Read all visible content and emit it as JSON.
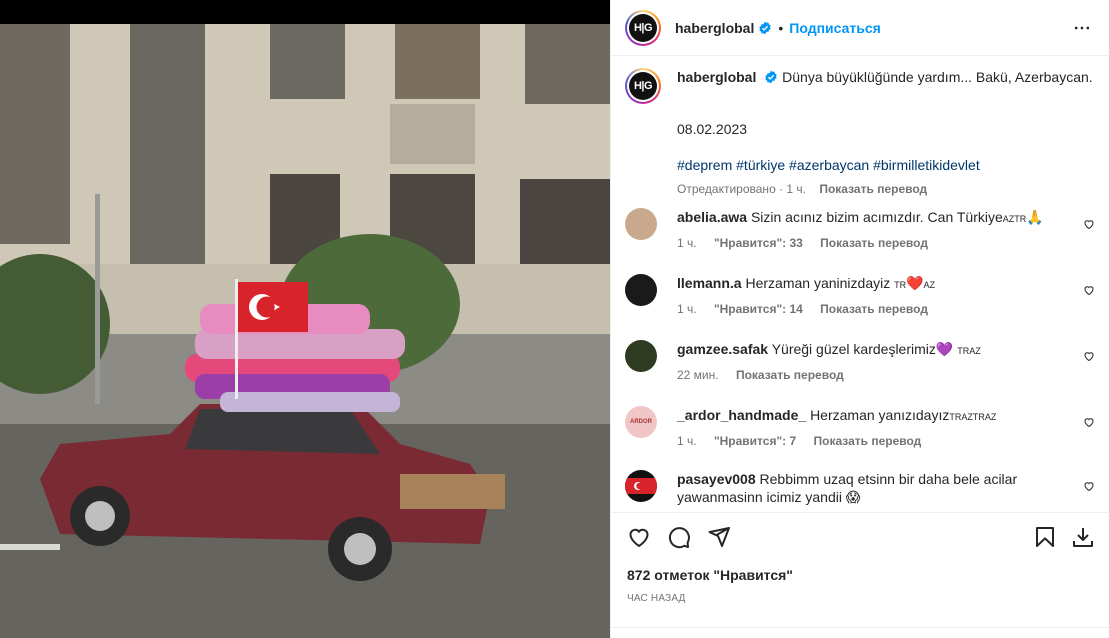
{
  "post": {
    "username": "haberglobal",
    "follow_label": "Подписаться",
    "dot": "•",
    "avatar_text": "H|G",
    "caption_text": "Dünya büyüklüğünde yardım... Bakü, Azerbaycan.",
    "date": "08.02.2023",
    "hashtags": "#deprem #türkiye #azerbaycan #birmilletikidevlet",
    "meta_edited": "Отредактировано · 1 ч.",
    "meta_translate": "Показать перевод"
  },
  "comments": [
    {
      "username": "abelia.awa",
      "text": "Sizin acınız bizim acımızdır. Can Türkiye",
      "suffix_small": "AZTR",
      "emoji": "🙏",
      "time": "1 ч.",
      "likes": "\"Нравится\": 33",
      "translate": "Показать перевод",
      "avatar_color": "#c9a98e"
    },
    {
      "username": "llemann.a",
      "text": "Herzaman yaninizdayiz ",
      "prefix_small": "TR",
      "emoji": "❤️",
      "suffix_small": "AZ",
      "time": "1 ч.",
      "likes": "\"Нравится\": 14",
      "translate": "Показать перевод",
      "avatar_color": "#1a1a1a"
    },
    {
      "username": "gamzee.safak",
      "text": "Yüreği güzel kardeşlerimiz",
      "emoji": "💜",
      "suffix_small": "TRAZ",
      "time": "22 мин.",
      "likes": "",
      "translate": "Показать перевод",
      "avatar_color": "#2f3b20"
    },
    {
      "username": "_ardor_handmade_",
      "text": "Herzaman yanızıdayız",
      "suffix_small": "TRAZTRAZ",
      "time": "1 ч.",
      "likes": "\"Нравится\": 7",
      "translate": "Показать перевод",
      "avatar_color": "#f1c6c6",
      "avatar_text": "ARDOR"
    },
    {
      "username": "pasayev008",
      "text": "Rebbimm uzaq etsinn bir daha bele acilar yawanmasinn icimiz yandii",
      "emoji": "😱",
      "time": "",
      "likes": "",
      "translate": "",
      "avatar_color": "#111111"
    }
  ],
  "actions": {
    "likes_count": "872 отметок \"Нравится\"",
    "time_ago": "ЧАС НАЗАД"
  },
  "icons": [
    "verified-icon",
    "more-icon",
    "heart-icon",
    "comment-icon",
    "share-icon",
    "bookmark-icon",
    "download-icon"
  ],
  "colors": {
    "link": "#0095f6",
    "hashtag": "#00376b",
    "muted": "#737373",
    "heart_red": "#e0245e"
  }
}
